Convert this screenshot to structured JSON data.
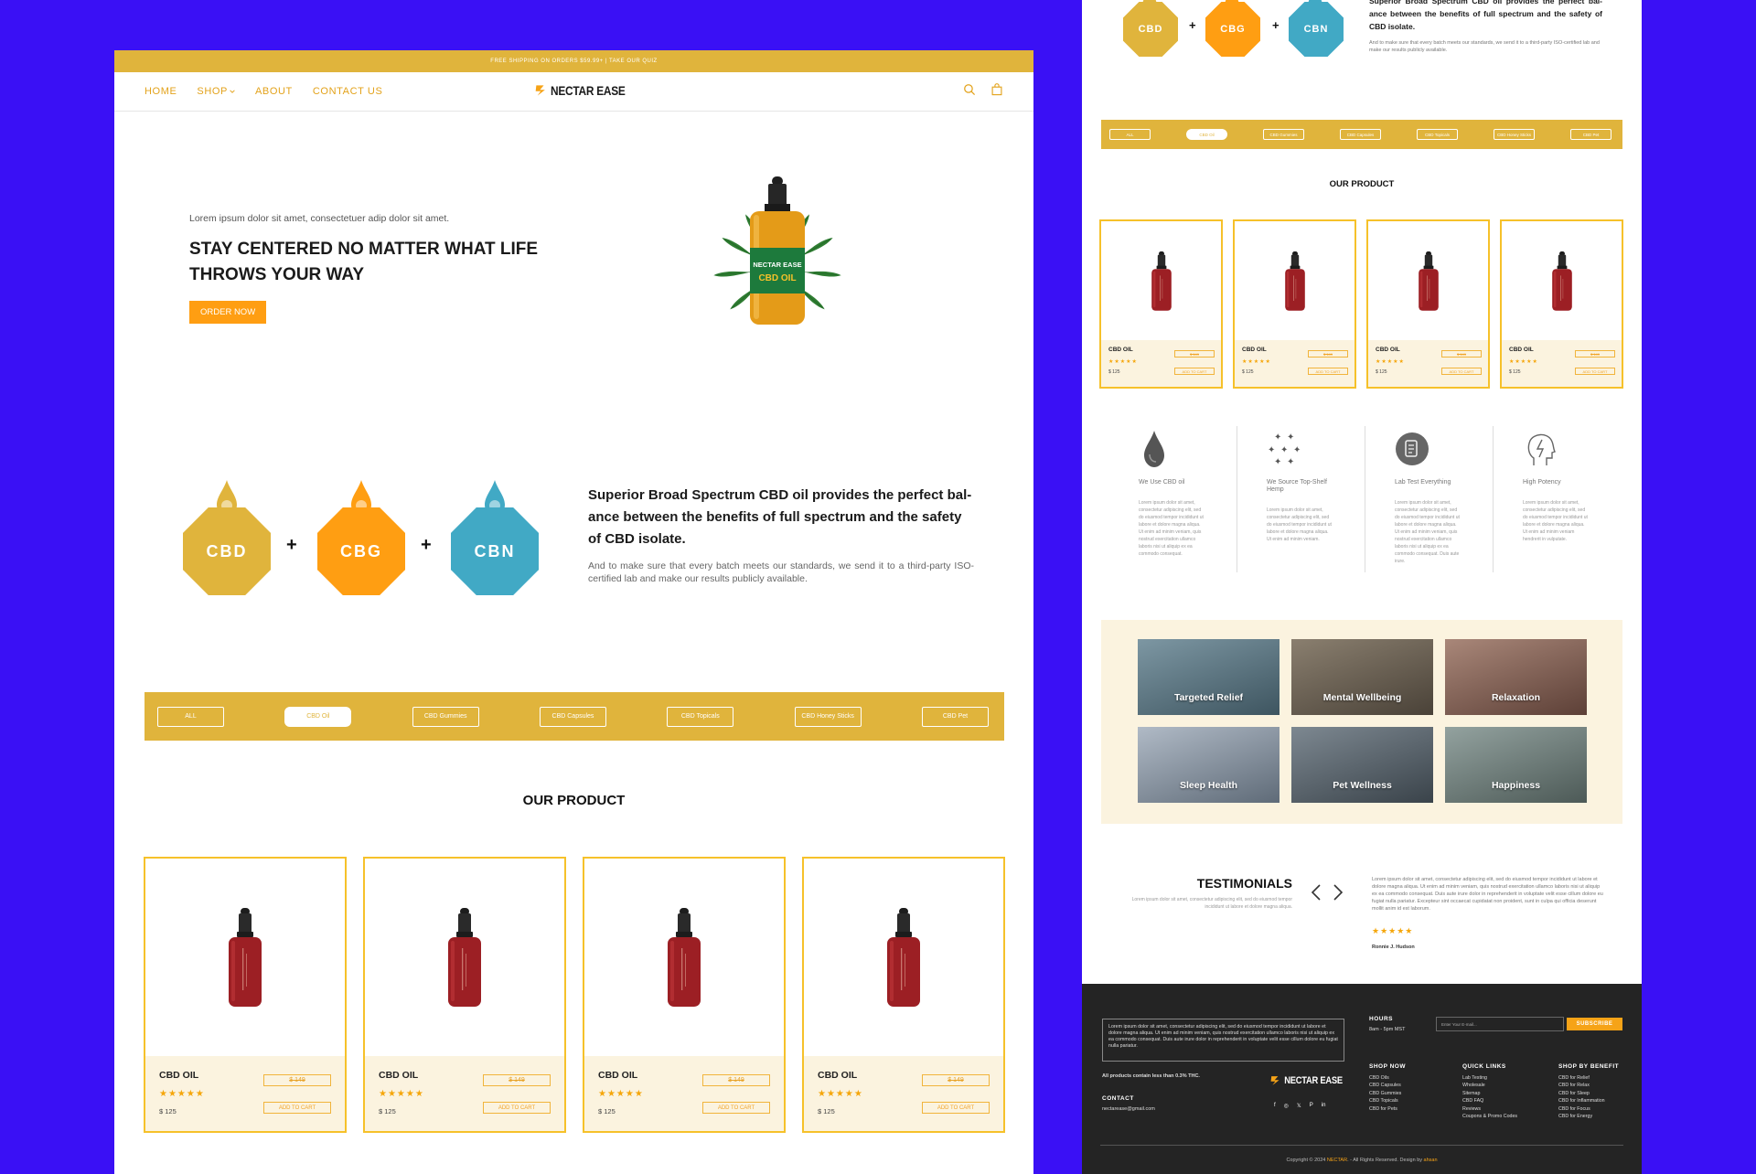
{
  "brand": {
    "name": "NECTAR EASE"
  },
  "topbar": {
    "text": "FREE SHIPPING ON ORDERS $59.99+ | TAKE OUR QUIZ"
  },
  "nav": {
    "items": [
      {
        "label": "HOME"
      },
      {
        "label": "SHOP"
      },
      {
        "label": "ABOUT"
      },
      {
        "label": "CONTACT US"
      }
    ]
  },
  "hero": {
    "subtitle": "Lorem ipsum dolor sit amet, consectetuer adip dolor sit amet.",
    "title": "STAY CENTERED NO MATTER WHAT LIFE THROWS YOUR WAY",
    "button": "ORDER NOW",
    "bottle_label": "NECTAR EASE",
    "bottle_sub": "CBD OIL"
  },
  "compounds": [
    {
      "label": "CBD",
      "color": "#e0b43c"
    },
    {
      "label": "CBG",
      "color": "#ff9e12"
    },
    {
      "label": "CBN",
      "color": "#41a9c5"
    }
  ],
  "plus_sign": "+",
  "spectrum": {
    "title": "Superior Broad Spectrum CBD oil provides the perfect bal-ance between the benefits of full spectrum and the safety of CBD isolate.",
    "body": "And to make sure that every batch meets our standards, we send it to a third-party ISO-certified lab and make our results publicly available."
  },
  "filters": [
    {
      "label": "ALL",
      "active": false
    },
    {
      "label": "CBD Oil",
      "active": true
    },
    {
      "label": "CBD Gummies",
      "active": false
    },
    {
      "label": "CBD Capsules",
      "active": false
    },
    {
      "label": "CBD Topicals",
      "active": false
    },
    {
      "label": "CBD Honey Sticks",
      "active": false
    },
    {
      "label": "CBD Pet",
      "active": false
    }
  ],
  "products_title": "OUR PRODUCT",
  "products": [
    {
      "name": "CBD OIL",
      "stars": "★★★★★",
      "old_price": "$ 149",
      "price": "$ 125",
      "button": "ADD TO CART"
    },
    {
      "name": "CBD OIL",
      "stars": "★★★★★",
      "old_price": "$ 149",
      "price": "$ 125",
      "button": "ADD TO CART"
    },
    {
      "name": "CBD OIL",
      "stars": "★★★★★",
      "old_price": "$ 149",
      "price": "$ 125",
      "button": "ADD TO CART"
    },
    {
      "name": "CBD OIL",
      "stars": "★★★★★",
      "old_price": "$ 149",
      "price": "$ 125",
      "button": "ADD TO CART"
    }
  ],
  "features": [
    {
      "title": "We Use CBD oil",
      "icon": "drop-icon",
      "body": "Lorem ipsum dolor sit amet, consectetur adipiscing elit, sed do eiusmod tempor incididunt ut labore et dolore magna aliqua. Ut enim ad minim veniam, quis nostrud exercitation ullamco laboris nisi ut aliquip ex ea commodo consequat."
    },
    {
      "title": "We Source Top-Shelf Hemp",
      "icon": "stars-icon",
      "body": "Lorem ipsum dolor sit amet, consectetur adipiscing elit, sed do eiusmod tempor incididunt ut labore et dolore magna aliqua. Ut enim ad minim veniam."
    },
    {
      "title": "Lab Test Everything",
      "icon": "lab-badge-icon",
      "body": "Lorem ipsum dolor sit amet, consectetur adipiscing elit, sed do eiusmod tempor incididunt ut labore et dolore magna aliqua. Ut enim ad minim veniam, quis nostrud exercitation ullamco laboris nisi ut aliquip ex ea commodo consequat. Duis aute irure."
    },
    {
      "title": "High Potency",
      "icon": "head-icon",
      "body": "Lorem ipsum dolor sit amet, consectetur adipiscing elit, sed do eiusmod tempor incididunt ut labore et dolore magna aliqua. Ut enim ad minim veniam hendrerit in vulputate."
    }
  ],
  "benefits": [
    {
      "label": "Targeted Relief",
      "color": "#5d7b8a"
    },
    {
      "label": "Mental Wellbeing",
      "color": "#6e6659"
    },
    {
      "label": "Relaxation",
      "color": "#8a6a5e"
    },
    {
      "label": "Sleep Health",
      "color": "#8e9aa8"
    },
    {
      "label": "Pet Wellness",
      "color": "#5c6770"
    },
    {
      "label": "Happiness",
      "color": "#6f7f7c"
    }
  ],
  "testimonials": {
    "title": "TESTIMONIALS",
    "subtitle": "Lorem ipsum dolor sit amet, consectetur adipiscing elit, sed do eiusmod tempor incididunt ut labore et dolore magna aliqua.",
    "body": "Lorem ipsum dolor sit amet, consectetur adipiscing elit, sed do eiusmod tempor incididunt ut labore et dolore magna aliqua. Ut enim ad minim veniam, quis nostrud exercitation ullamco laboris nisi ut aliquip ex ea commodo consequat. Duis aute irure dolor in reprehenderit in voluptate velit esse cillum dolore eu fugiat nulla pariatur. Excepteur sint occaecat cupidatat non proident, sunt in culpa qui officia deserunt mollit anim id est laborum.",
    "stars": "★★★★★",
    "author": "Ronnie J. Hudson"
  },
  "footer": {
    "about": "Lorem ipsum dolor sit amet, consectetur adipiscing elit, sed do eiusmod tempor incididunt ut labore et dolore magna aliqua. Ut enim ad minim veniam, quis nostrud exercitation ullamco laboris nisi ut aliquip ex ea commodo consequat. Duis aute irure dolor in reprehenderit in voluptate velit esse cillum dolore eu fugiat nulla pariatur.",
    "thc_note": "All products contain less than 0.3% THC.",
    "contact_head": "CONTACT",
    "contact_email": "nectarease@gmail.com",
    "hours_head": "HOURS",
    "hours": "8am - 5pm MST",
    "email_placeholder": "Enter Your E-mail...",
    "subscribe": "SUBSCRIBE",
    "shop_now": {
      "head": "SHOP NOW",
      "items": [
        "CBD Oils",
        "CBD Capsules",
        "CBD Gummies",
        "CBD Topicals",
        "CBD for Pets"
      ]
    },
    "quick_links": {
      "head": "QUICK LINKS",
      "items": [
        "Lab Testing",
        "Wholesale",
        "Sitemap",
        "CBD FAQ",
        "Reviews",
        "Coupons & Promo Codes"
      ]
    },
    "shop_benefit": {
      "head": "SHOP BY BENEFIT",
      "items": [
        "CBD for Relief",
        "CBD for Relax",
        "CBD for Sleep",
        "CBD for Inflammation",
        "CBD for Focus",
        "CBD for Energy"
      ]
    },
    "social": [
      "f",
      "◎",
      "𝕏",
      "P",
      "in"
    ],
    "copy_pre": "Copyright © 2024",
    "copy_brand": "NECTAR",
    "copy_mid": ". - All Rights Reserved. Design by",
    "copy_designer": "ahsan"
  },
  "colors": {
    "accent": "#e0b43c",
    "orange": "#ff9e12",
    "teal": "#41a9c5",
    "background": "#3a10f5",
    "footer": "#242424",
    "bottle": "#9c1f24"
  }
}
